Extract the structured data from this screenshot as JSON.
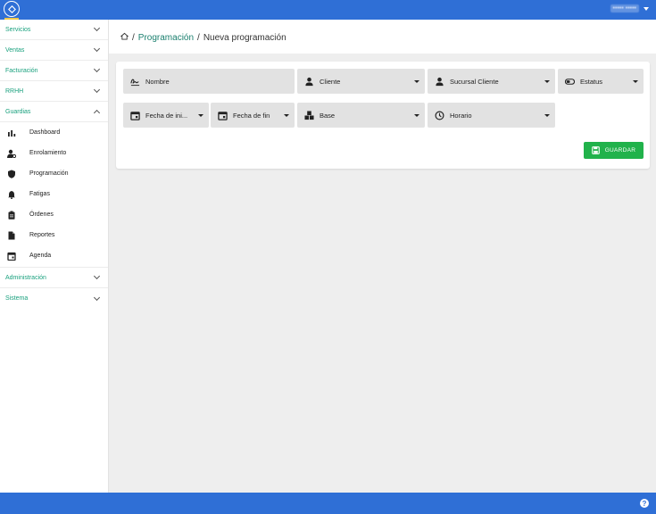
{
  "topbar": {
    "user_name": "••••• •••••"
  },
  "sidebar": {
    "menus_top": [
      {
        "label": "Servicios"
      },
      {
        "label": "Ventas"
      },
      {
        "label": "Facturación"
      },
      {
        "label": "RRHH"
      },
      {
        "label": "Guardias"
      }
    ],
    "guardias_items": [
      {
        "label": "Dashboard",
        "icon": "bar-chart-icon"
      },
      {
        "label": "Enrolamiento",
        "icon": "user-settings-icon"
      },
      {
        "label": "Programación",
        "icon": "shield-icon"
      },
      {
        "label": "Fatigas",
        "icon": "bell-icon"
      },
      {
        "label": "Órdenes",
        "icon": "clipboard-icon"
      },
      {
        "label": "Reportes",
        "icon": "file-icon"
      },
      {
        "label": "Agenda",
        "icon": "calendar-icon"
      }
    ],
    "menus_bottom": [
      {
        "label": "Administración"
      },
      {
        "label": "Sistema"
      }
    ]
  },
  "breadcrumb": {
    "separator": "/",
    "parent": "Programación",
    "current": "Nueva programación"
  },
  "form": {
    "nombre": "Nombre",
    "cliente": "Cliente",
    "sucursal": "Sucursal Cliente",
    "estatus": "Estatus",
    "fecha_inicio": "Fecha de ini...",
    "fecha_fin": "Fecha de fin",
    "base": "Base",
    "horario": "Horario",
    "save_label": "GUARDAR"
  },
  "colors": {
    "primary": "#2f6fd6",
    "accent": "#1aa17e",
    "save": "#21b24b"
  },
  "footer": {
    "help": "?"
  }
}
